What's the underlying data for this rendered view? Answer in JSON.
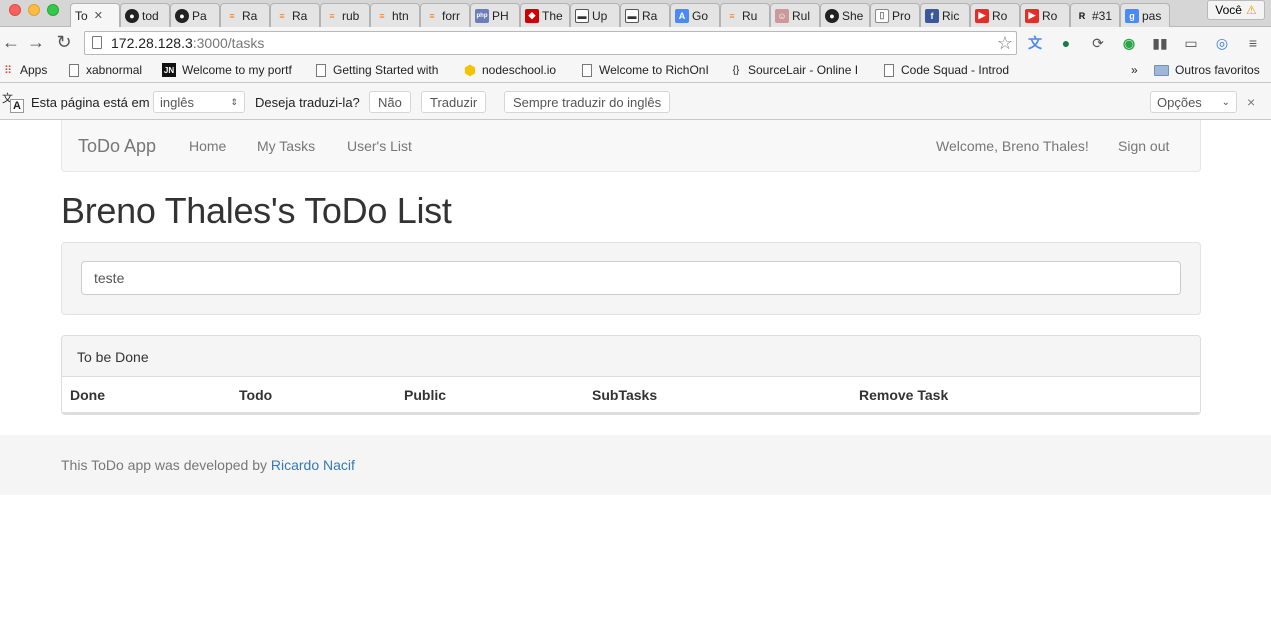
{
  "browser": {
    "profile": "Você",
    "tabs": [
      {
        "label": "To",
        "icon": "page-icon",
        "active": true
      },
      {
        "label": "tod",
        "icon": "github-icon"
      },
      {
        "label": "Pa",
        "icon": "github-icon"
      },
      {
        "label": "Ra",
        "icon": "stackoverflow-icon"
      },
      {
        "label": "Ra",
        "icon": "stackoverflow-icon"
      },
      {
        "label": "rub",
        "icon": "stackoverflow-icon"
      },
      {
        "label": "htn",
        "icon": "stackoverflow-icon"
      },
      {
        "label": "forr",
        "icon": "stackoverflow-icon"
      },
      {
        "label": "PH",
        "icon": "php-icon"
      },
      {
        "label": "The",
        "icon": "rails-icon"
      },
      {
        "label": "Up",
        "icon": "app-icon"
      },
      {
        "label": "Ra",
        "icon": "app-icon"
      },
      {
        "label": "Go",
        "icon": "translate-icon"
      },
      {
        "label": "Ru",
        "icon": "stackoverflow-icon"
      },
      {
        "label": "Rul",
        "icon": "avatar-icon"
      },
      {
        "label": "She",
        "icon": "github-icon"
      },
      {
        "label": "Pro",
        "icon": "page-icon"
      },
      {
        "label": "Ric",
        "icon": "facebook-icon"
      },
      {
        "label": "Ro",
        "icon": "youtube-icon"
      },
      {
        "label": "Ro",
        "icon": "youtube-icon"
      },
      {
        "label": "#31",
        "icon": "r-icon"
      },
      {
        "label": "pas",
        "icon": "google-icon"
      }
    ],
    "url_host": "172.28.128.3",
    "url_path": ":3000/tasks",
    "bookmarks": {
      "apps": "Apps",
      "items": [
        "xabnormal",
        "Welcome to my portf",
        "Getting Started with",
        "nodeschool.io",
        "Welcome to RichOnI",
        "SourceLair - Online I",
        "Code Squad - Introd"
      ],
      "more": "»",
      "other": "Outros favoritos"
    },
    "translate": {
      "prefix": "Esta página está em",
      "language": "inglês",
      "question": "Deseja traduzi-la?",
      "no": "Não",
      "translate": "Traduzir",
      "always": "Sempre traduzir do inglês",
      "options": "Opções",
      "close": "×"
    }
  },
  "navbar": {
    "brand": "ToDo App",
    "links": [
      "Home",
      "My Tasks",
      "User's List"
    ],
    "welcome": "Welcome, Breno Thales!",
    "sign_out": "Sign out"
  },
  "main": {
    "title": "Breno Thales's ToDo List",
    "new_task_value": "teste",
    "panel_heading": "To be Done",
    "columns": [
      "Done",
      "Todo",
      "Public",
      "SubTasks",
      "Remove Task"
    ]
  },
  "footer": {
    "text": "This ToDo app was developed by ",
    "author": "Ricardo Nacif"
  },
  "colors": {
    "link": "#337ab7",
    "navbar_bg": "#f8f8f8",
    "footer_bg": "#f5f5f5"
  }
}
